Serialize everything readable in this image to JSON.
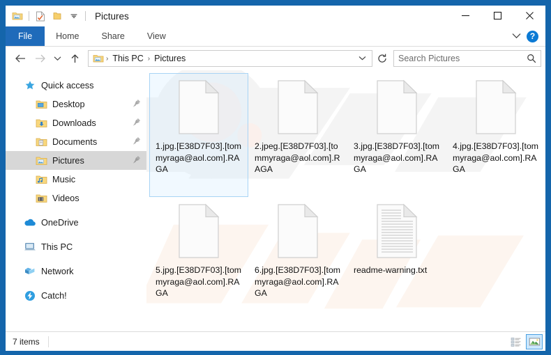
{
  "window": {
    "title": "Pictures",
    "border_color": "#1465ab",
    "quick_access_toolbar": [
      {
        "name": "pictures-folder-icon",
        "tooltip": "Pictures"
      },
      {
        "name": "properties-icon",
        "tooltip": "Properties"
      },
      {
        "name": "new-folder-icon",
        "tooltip": "New folder"
      },
      {
        "name": "customize-chevron-icon",
        "tooltip": "Customize Quick Access Toolbar"
      }
    ],
    "controls": {
      "minimize": "─",
      "maximize": "☐",
      "close": "✕"
    }
  },
  "ribbon": {
    "tabs": [
      {
        "label": "File",
        "active_accent": true
      },
      {
        "label": "Home",
        "active_accent": false
      },
      {
        "label": "Share",
        "active_accent": false
      },
      {
        "label": "View",
        "active_accent": false
      }
    ],
    "file_tab_color": "#1f6bba",
    "expand_chevron": "∨",
    "help_label": "?"
  },
  "address_bar": {
    "back": "←",
    "forward": "→",
    "recent": "∨",
    "up": "↑",
    "breadcrumb": {
      "icon": "pictures-folder-icon",
      "segments": [
        "This PC",
        "Pictures"
      ],
      "separator": "›",
      "dropdown": "∨"
    },
    "refresh": "↻"
  },
  "search": {
    "placeholder": "Search Pictures",
    "value": "",
    "icon": "search-icon"
  },
  "sidebar": {
    "groups": [
      {
        "header": {
          "label": "Quick access",
          "icon": "star-icon",
          "level": "root"
        },
        "items": [
          {
            "label": "Desktop",
            "icon": "folder-desktop-icon",
            "pinned": true,
            "selected": false
          },
          {
            "label": "Downloads",
            "icon": "folder-downloads-icon",
            "pinned": true,
            "selected": false
          },
          {
            "label": "Documents",
            "icon": "folder-documents-icon",
            "pinned": true,
            "selected": false
          },
          {
            "label": "Pictures",
            "icon": "folder-pictures-icon",
            "pinned": true,
            "selected": true
          },
          {
            "label": "Music",
            "icon": "folder-music-icon",
            "pinned": false,
            "selected": false
          },
          {
            "label": "Videos",
            "icon": "folder-videos-icon",
            "pinned": false,
            "selected": false
          }
        ]
      },
      {
        "header": {
          "label": "OneDrive",
          "icon": "onedrive-cloud-icon",
          "level": "root"
        },
        "items": []
      },
      {
        "header": {
          "label": "This PC",
          "icon": "this-pc-icon",
          "level": "root"
        },
        "items": []
      },
      {
        "header": {
          "label": "Network",
          "icon": "network-icon",
          "level": "root"
        },
        "items": []
      },
      {
        "header": {
          "label": "Catch!",
          "icon": "catch-app-icon",
          "level": "root"
        },
        "items": []
      }
    ],
    "pin_glyph": "📌"
  },
  "files": [
    {
      "name": "1.jpg.[E38D7F03].[tommyraga@aol.com].RAGA",
      "type": "blank",
      "selected": true
    },
    {
      "name": "2.jpeg.[E38D7F03].[tommyraga@aol.com].RAGA",
      "type": "blank",
      "selected": false
    },
    {
      "name": "3.jpg.[E38D7F03].[tommyraga@aol.com].RAGA",
      "type": "blank",
      "selected": false
    },
    {
      "name": "4.jpg.[E38D7F03].[tommyraga@aol.com].RAGA",
      "type": "blank",
      "selected": false
    },
    {
      "name": "5.jpg.[E38D7F03].[tommyraga@aol.com].RAGA",
      "type": "blank",
      "selected": false
    },
    {
      "name": "6.jpg.[E38D7F03].[tommyraga@aol.com].RAGA",
      "type": "blank",
      "selected": false
    },
    {
      "name": "readme-warning.txt",
      "type": "text",
      "selected": false
    }
  ],
  "status_bar": {
    "item_count": "7 items",
    "views": [
      {
        "name": "details-view-button",
        "active": false
      },
      {
        "name": "large-icons-view-button",
        "active": true
      }
    ]
  }
}
